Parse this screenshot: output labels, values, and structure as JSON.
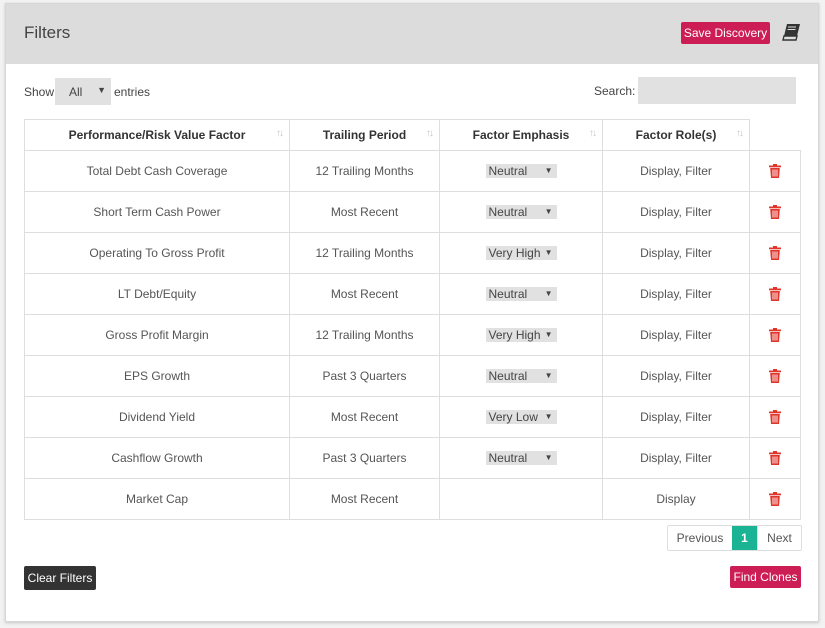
{
  "header": {
    "title": "Filters",
    "save_label": "Save Discovery",
    "book_icon": "book-icon"
  },
  "controls": {
    "show_label": "Show",
    "entries_value": "All",
    "entries_label": "entries",
    "search_label": "Search:",
    "search_value": ""
  },
  "table": {
    "columns": [
      "Performance/Risk Value Factor",
      "Trailing Period",
      "Factor Emphasis",
      "Factor Role(s)"
    ],
    "rows": [
      {
        "factor": "Total Debt Cash Coverage",
        "period": "12 Trailing Months",
        "emphasis": "Neutral",
        "roles": "Display, Filter"
      },
      {
        "factor": "Short Term Cash Power",
        "period": "Most Recent",
        "emphasis": "Neutral",
        "roles": "Display, Filter"
      },
      {
        "factor": "Operating To Gross Profit",
        "period": "12 Trailing Months",
        "emphasis": "Very High",
        "roles": "Display, Filter"
      },
      {
        "factor": "LT Debt/Equity",
        "period": "Most Recent",
        "emphasis": "Neutral",
        "roles": "Display, Filter"
      },
      {
        "factor": "Gross Profit Margin",
        "period": "12 Trailing Months",
        "emphasis": "Very High",
        "roles": "Display, Filter"
      },
      {
        "factor": "EPS Growth",
        "period": "Past 3 Quarters",
        "emphasis": "Neutral",
        "roles": "Display, Filter"
      },
      {
        "factor": "Dividend Yield",
        "period": "Most Recent",
        "emphasis": "Very Low",
        "roles": "Display, Filter"
      },
      {
        "factor": "Cashflow Growth",
        "period": "Past 3 Quarters",
        "emphasis": "Neutral",
        "roles": "Display, Filter"
      },
      {
        "factor": "Market Cap",
        "period": "Most Recent",
        "emphasis": "",
        "roles": "Display"
      }
    ]
  },
  "pagination": {
    "previous_label": "Previous",
    "current_page": "1",
    "next_label": "Next"
  },
  "footer": {
    "clear_label": "Clear Filters",
    "find_label": "Find Clones"
  },
  "colors": {
    "accent_pink": "#cc1e54",
    "page_active": "#1ab394",
    "trash_red": "#e0352b",
    "header_bg": "#dcdcdc"
  }
}
